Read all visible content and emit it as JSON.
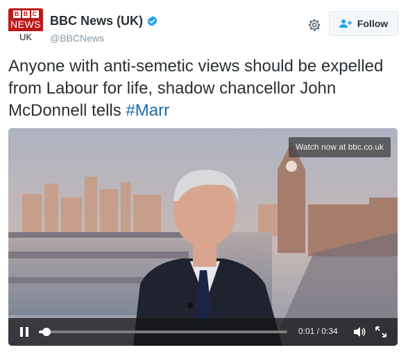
{
  "header": {
    "avatar": {
      "logo_top": "BBC",
      "logo_bottom": "NEWS",
      "region": "UK"
    },
    "display_name": "BBC News (UK)",
    "verified_icon": "verified-badge-icon",
    "handle": "@BBCNews",
    "gear_icon": "gear-icon",
    "follow_label": "Follow",
    "follow_icon": "add-user-icon"
  },
  "tweet": {
    "text": "Anyone with anti-semetic views should be expelled from Labour for life, shadow chancellor John McDonnell tells ",
    "hashtag": "#Marr"
  },
  "video": {
    "watch_label": "Watch now at bbc.co.uk",
    "time_display": "0:01 / 0:34",
    "progress_fraction": 0.03,
    "icons": {
      "pause": "pause-icon",
      "volume": "volume-icon",
      "fullscreen": "fullscreen-icon"
    }
  },
  "colors": {
    "link": "#1b6ba8",
    "verified": "#1da1f2",
    "bbc_red": "#bb1919"
  }
}
